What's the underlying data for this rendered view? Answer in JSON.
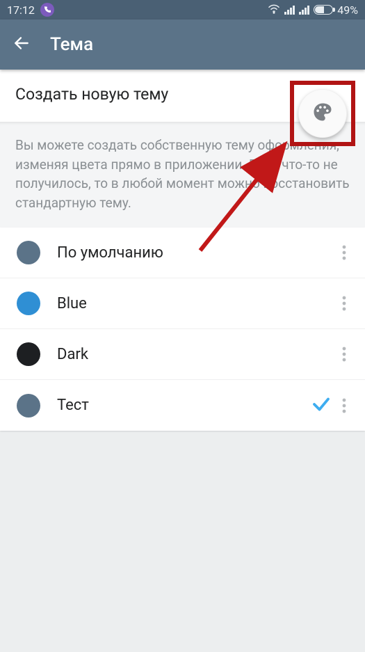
{
  "status": {
    "time": "17:12",
    "battery_text": "49%"
  },
  "header": {
    "title": "Тема"
  },
  "section": {
    "create_title": "Создать новую тему",
    "description": "Вы можете создать собственную тему оформления, изменяя цвета прямо в приложении. Если что-то не получилось, то в любой момент можно восстановить стандартную тему."
  },
  "themes": [
    {
      "name": "По умолчанию",
      "color": "#5b7388",
      "selected": false
    },
    {
      "name": "Blue",
      "color": "#2f8fd4",
      "selected": false
    },
    {
      "name": "Dark",
      "color": "#1d1f22",
      "selected": false
    },
    {
      "name": "Тест",
      "color": "#5b7388",
      "selected": true
    }
  ]
}
